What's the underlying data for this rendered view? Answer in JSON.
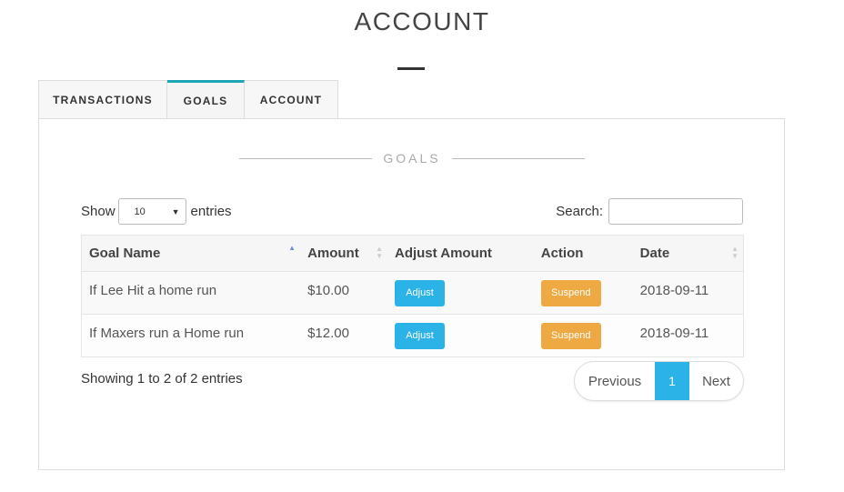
{
  "page": {
    "title": "ACCOUNT"
  },
  "tabs": [
    {
      "label": "TRANSACTIONS",
      "active": false
    },
    {
      "label": "GOALS",
      "active": true
    },
    {
      "label": "ACCOUNT",
      "active": false
    }
  ],
  "section": {
    "heading": "GOALS"
  },
  "length": {
    "prefix": "Show",
    "value": "10",
    "suffix": "entries"
  },
  "search": {
    "label": "Search:",
    "value": ""
  },
  "table": {
    "columns": [
      "Goal Name",
      "Amount",
      "Adjust Amount",
      "Action",
      "Date"
    ],
    "rows": [
      {
        "goal": "If Lee Hit a home run",
        "amount": "$10.00",
        "adjust": "Adjust",
        "action": "Suspend",
        "date": "2018-09-11"
      },
      {
        "goal": "If Maxers run a Home run",
        "amount": "$12.00",
        "adjust": "Adjust",
        "action": "Suspend",
        "date": "2018-09-11"
      }
    ]
  },
  "info": "Showing 1 to 2 of 2 entries",
  "pagination": {
    "previous": "Previous",
    "current": "1",
    "next": "Next"
  },
  "colors": {
    "accent_tab": "#1fa6b5",
    "adjust_button": "#2bb3e8",
    "suspend_button": "#efa943",
    "current_page": "#2bb3e8"
  }
}
